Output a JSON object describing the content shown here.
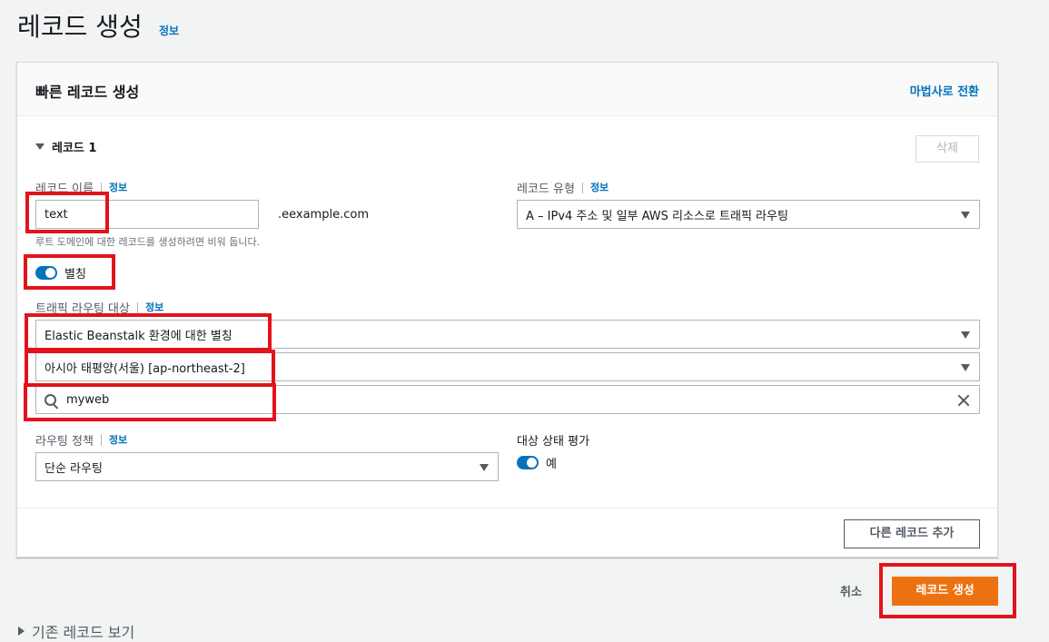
{
  "page": {
    "title": "레코드 생성",
    "info": "정보"
  },
  "panel": {
    "title": "빠른 레코드 생성",
    "wizard_link": "마법사로 전환"
  },
  "record": {
    "section_label": "레코드 1",
    "delete_label": "삭제",
    "name_label": "레코드 이름",
    "name_info": "정보",
    "name_value": "text",
    "domain_suffix": ".eexample.com",
    "name_hint": "루트 도메인에 대한 레코드를 생성하려면 비워 둡니다.",
    "type_label": "레코드 유형",
    "type_info": "정보",
    "type_value": "A – IPv4 주소 및 일부 AWS 리소스로 트래픽 라우팅",
    "alias_label": "별칭",
    "target_label": "트래픽 라우팅 대상",
    "target_info": "정보",
    "target_service": "Elastic Beanstalk 환경에 대한 별칭",
    "target_region": "아시아 태평양(서울) [ap-northeast-2]",
    "target_search_value": "myweb",
    "policy_label": "라우팅 정책",
    "policy_info": "정보",
    "policy_value": "단순 라우팅",
    "health_label": "대상 상태 평가",
    "health_value": "예"
  },
  "footer": {
    "add_record": "다른 레코드 추가",
    "cancel": "취소",
    "create": "레코드 생성",
    "existing_records": "기존 레코드 보기"
  },
  "colors": {
    "accent": "#0073bb",
    "primary_button": "#ec7211",
    "highlight": "#e3131b"
  }
}
